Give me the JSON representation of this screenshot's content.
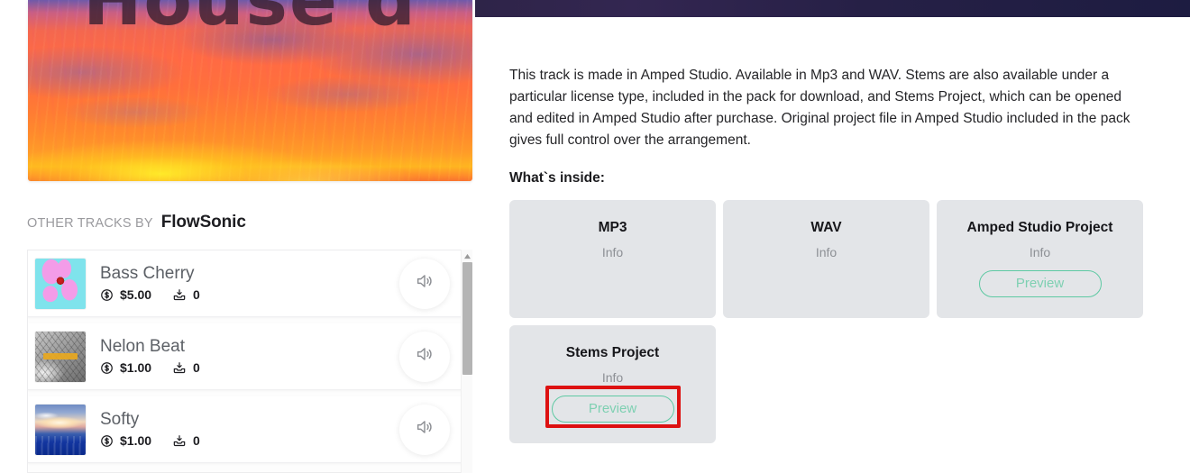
{
  "artwork": {
    "overlay_title": "House d",
    "alt": "sunset-sky-album-art"
  },
  "other_tracks": {
    "label": "OTHER TRACKS BY",
    "artist": "FlowSonic",
    "tracks": [
      {
        "title": "Bass Cherry",
        "price": "$5.00",
        "downloads": "0",
        "thumb": "cherry-artwork",
        "play_icon": "speaker-icon"
      },
      {
        "title": "Nelon Beat",
        "price": "$1.00",
        "downloads": "0",
        "thumb": "nelon-artwork",
        "play_icon": "speaker-icon"
      },
      {
        "title": "Softy",
        "price": "$1.00",
        "downloads": "0",
        "thumb": "softy-artwork",
        "play_icon": "speaker-icon"
      }
    ],
    "scrollbar": {
      "up_arrow_icon": "caret-up-icon"
    }
  },
  "details": {
    "description": "This track is made in Amped Studio. Available in Mp3 and WAV. Stems are also available under a particular license type, included in the pack for download, and Stems Project, which can be opened and edited in Amped Studio after purchase. Original project file in Amped Studio included in the pack gives full control over the arrangement.",
    "whats_inside_label": "What`s inside:",
    "cards": [
      {
        "title": "MP3",
        "info": "Info",
        "preview_label": null
      },
      {
        "title": "WAV",
        "info": "Info",
        "preview_label": null
      },
      {
        "title": "Amped Studio Project",
        "info": "Info",
        "preview_label": "Preview"
      },
      {
        "title": "Stems Project",
        "info": "Info",
        "preview_label": "Preview"
      }
    ]
  },
  "colors": {
    "header_bar": "#2a2350",
    "card_bg": "#e3e5e8",
    "preview_border": "#5ec9a3",
    "preview_text": "#7ed0b2",
    "annotation": "#dd1111",
    "track_title": "#5c6066",
    "muted_text": "#8d9095"
  }
}
